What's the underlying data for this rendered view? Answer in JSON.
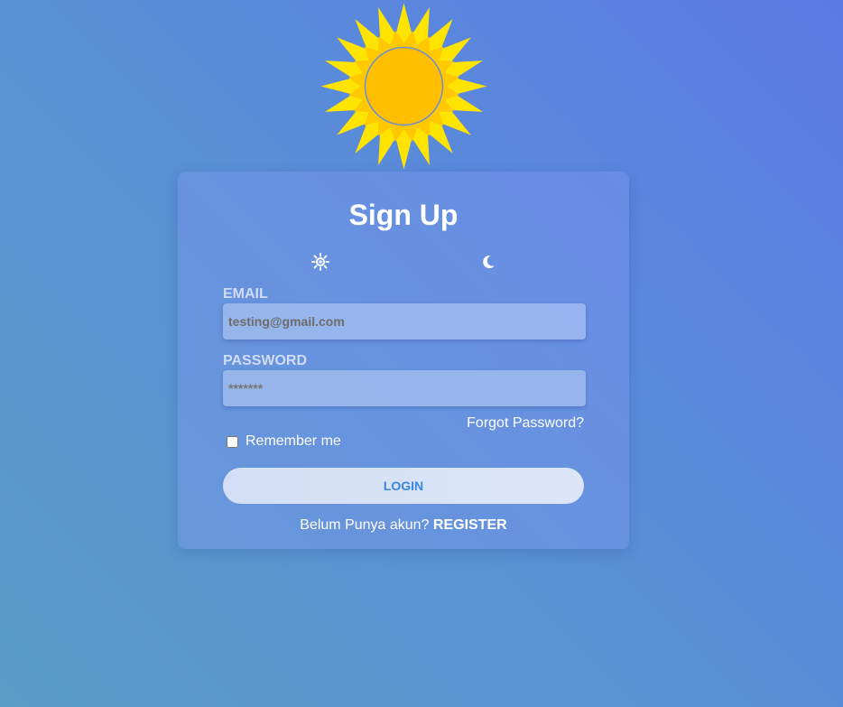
{
  "logo": {
    "icon": "sun-logo-icon",
    "colors": {
      "rays": "#ffe400",
      "inner_rays": "#ffc800",
      "disc": "#ffbe00",
      "disc_border": "#6a8fd8"
    }
  },
  "card": {
    "title": "Sign Up",
    "theme_toggle": {
      "light_icon": "sun-icon",
      "dark_icon": "moon-icon"
    },
    "email": {
      "label": "EMAIL",
      "value": "testing@gmail.com",
      "placeholder": ""
    },
    "password": {
      "label": "PASSWORD",
      "value": "",
      "placeholder": "*******"
    },
    "forgot_password": "Forgot Password?",
    "remember_me": {
      "label": "Remember me",
      "checked": false
    },
    "login_label": "LOGIN",
    "register_prompt": "Belum Punya akun?",
    "register_label": "REGISTER"
  },
  "colors": {
    "accent": "#3a86e0",
    "background_start": "#5a7be6",
    "background_end": "#5a9dc6"
  }
}
